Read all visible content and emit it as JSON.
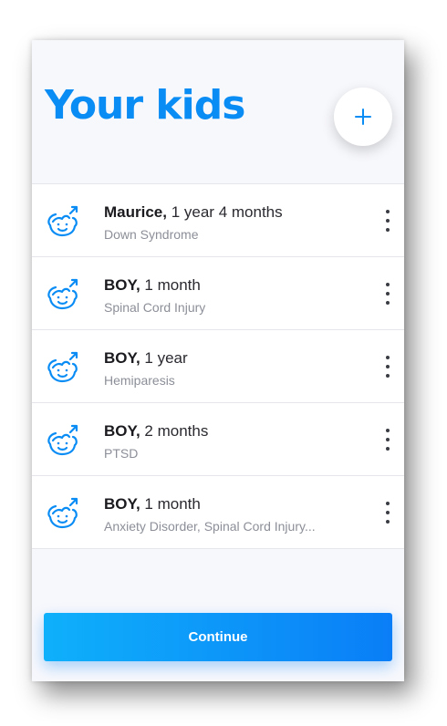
{
  "header": {
    "title": "Your kids",
    "add_button_icon": "plus-icon"
  },
  "kids": [
    {
      "name": "Maurice,",
      "age": "1 year 4 months",
      "condition": "Down Syndrome",
      "icon": "boy-face-icon",
      "menu_icon": "more-vertical-icon"
    },
    {
      "name": "BOY,",
      "age": "1 month",
      "condition": "Spinal Cord Injury",
      "icon": "boy-face-icon",
      "menu_icon": "more-vertical-icon"
    },
    {
      "name": "BOY,",
      "age": "1 year",
      "condition": "Hemiparesis",
      "icon": "boy-face-icon",
      "menu_icon": "more-vertical-icon"
    },
    {
      "name": "BOY,",
      "age": "2 months",
      "condition": "PTSD",
      "icon": "boy-face-icon",
      "menu_icon": "more-vertical-icon"
    },
    {
      "name": "BOY,",
      "age": "1 month",
      "condition": "Anxiety Disorder, Spinal Cord Injury...",
      "icon": "boy-face-icon",
      "menu_icon": "more-vertical-icon"
    }
  ],
  "footer": {
    "continue_label": "Continue"
  },
  "colors": {
    "accent": "#0a8cf5",
    "button_gradient_start": "#0fb0fb",
    "button_gradient_end": "#0a7ef7",
    "background": "#f7f8fc"
  }
}
